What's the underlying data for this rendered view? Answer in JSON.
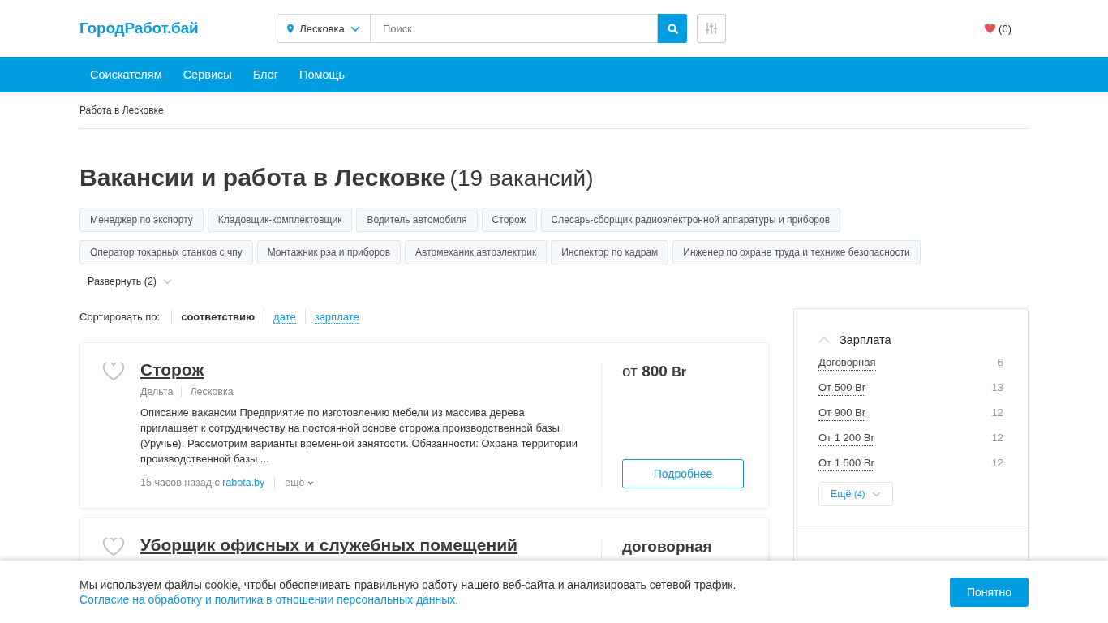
{
  "header": {
    "logo": "ГородРабот.бай",
    "location": "Лесковка",
    "search": {
      "placeholder": "Поиск"
    },
    "favorites": "(0)"
  },
  "nav": [
    {
      "label": "Соискателям"
    },
    {
      "label": "Сервисы"
    },
    {
      "label": "Блог"
    },
    {
      "label": "Помощь"
    }
  ],
  "breadcrumb": "Работа в Лесковке",
  "heading": {
    "title": "Вакансии и работа в Лесковке",
    "count": "(19 вакансий)"
  },
  "tag_rows": [
    [
      "Менеджер по экспорту",
      "Кладовщик-комплектовщик",
      "Водитель автомобиля",
      "Сторож",
      "Слесарь-сборщик радиоэлектронной аппаратуры и приборов"
    ],
    [
      "Оператор токарных станков с чпу",
      "Монтажник рэа и приборов",
      "Автомеханик автоэлектрик",
      "Инспектор по кадрам",
      "Инженер по охране труда и технике безопасности"
    ]
  ],
  "expand": "Развернуть (2)",
  "sort": {
    "label": "Сортировать по:",
    "options": [
      {
        "label": "соответствию",
        "selected": true
      },
      {
        "label": "дате",
        "selected": false
      },
      {
        "label": "зарплате",
        "selected": false
      }
    ]
  },
  "jobs": [
    {
      "title": "Сторож",
      "company": "Дельта",
      "city": "Лесковка",
      "description": "Описание вакансии Предприятие по изготовлению мебели из массива дерева приглашает к сотрудничеству на постоянной основе сторожа производственной базы (Уручье). Рассмотрим варианты временной занятости. Обязанности: Охрана территории производственной базы ...",
      "posted": "15 часов назад с",
      "source": "rabota.by",
      "more": "ещё",
      "salary_prefix": "от",
      "salary": "800",
      "currency": "Br",
      "button": "Подробнее"
    },
    {
      "title": "Уборщик офисных и служебных помещений",
      "salary": "договорная"
    }
  ],
  "filter": {
    "title": "Зарплата",
    "expanded": true,
    "options": [
      {
        "label": "Договорная",
        "count": "6"
      },
      {
        "label": "От 500 Br",
        "count": "13"
      },
      {
        "label": "От 900 Br",
        "count": "12"
      },
      {
        "label": "От 1 200 Br",
        "count": "12"
      },
      {
        "label": "От 1 500 Br",
        "count": "12"
      }
    ],
    "more": "Ещё",
    "more_count": "(4)"
  },
  "cookie": {
    "text": "Мы используем файлы cookie, чтобы обеспечивать правильную работу нашего веб-сайта и анализировать сетевой трафик.",
    "link": "Согласие на обработку и политика в отношении персональных данных.",
    "button": "Понятно"
  }
}
